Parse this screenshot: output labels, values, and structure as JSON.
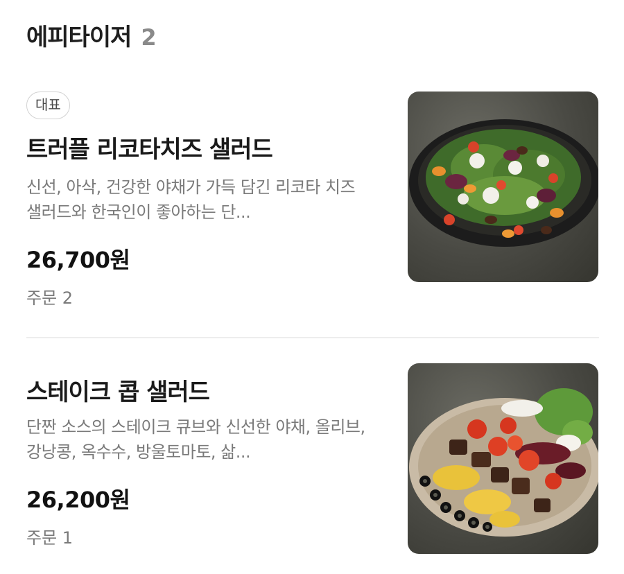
{
  "section": {
    "title": "에피타이저",
    "count": "2"
  },
  "items": [
    {
      "badge": "대표",
      "name": "트러플 리코타치즈 샐러드",
      "description": "신선, 아삭, 건강한 야채가 가득 담긴 리코타 치즈 샐러드와 한국인이 좋아하는 단...",
      "price": "26,700원",
      "orders": "주문 2"
    },
    {
      "name": "스테이크 콥 샐러드",
      "description": "단짠 소스의 스테이크 큐브와 신선한 야채, 올리브, 강낭콩, 옥수수, 방울토마토, 삶...",
      "price": "26,200원",
      "orders": "주문 1"
    }
  ],
  "colors": {
    "text_primary": "#1a1a1a",
    "text_secondary": "#7a7a7a",
    "count": "#8a8a8a",
    "divider": "#ededed"
  }
}
